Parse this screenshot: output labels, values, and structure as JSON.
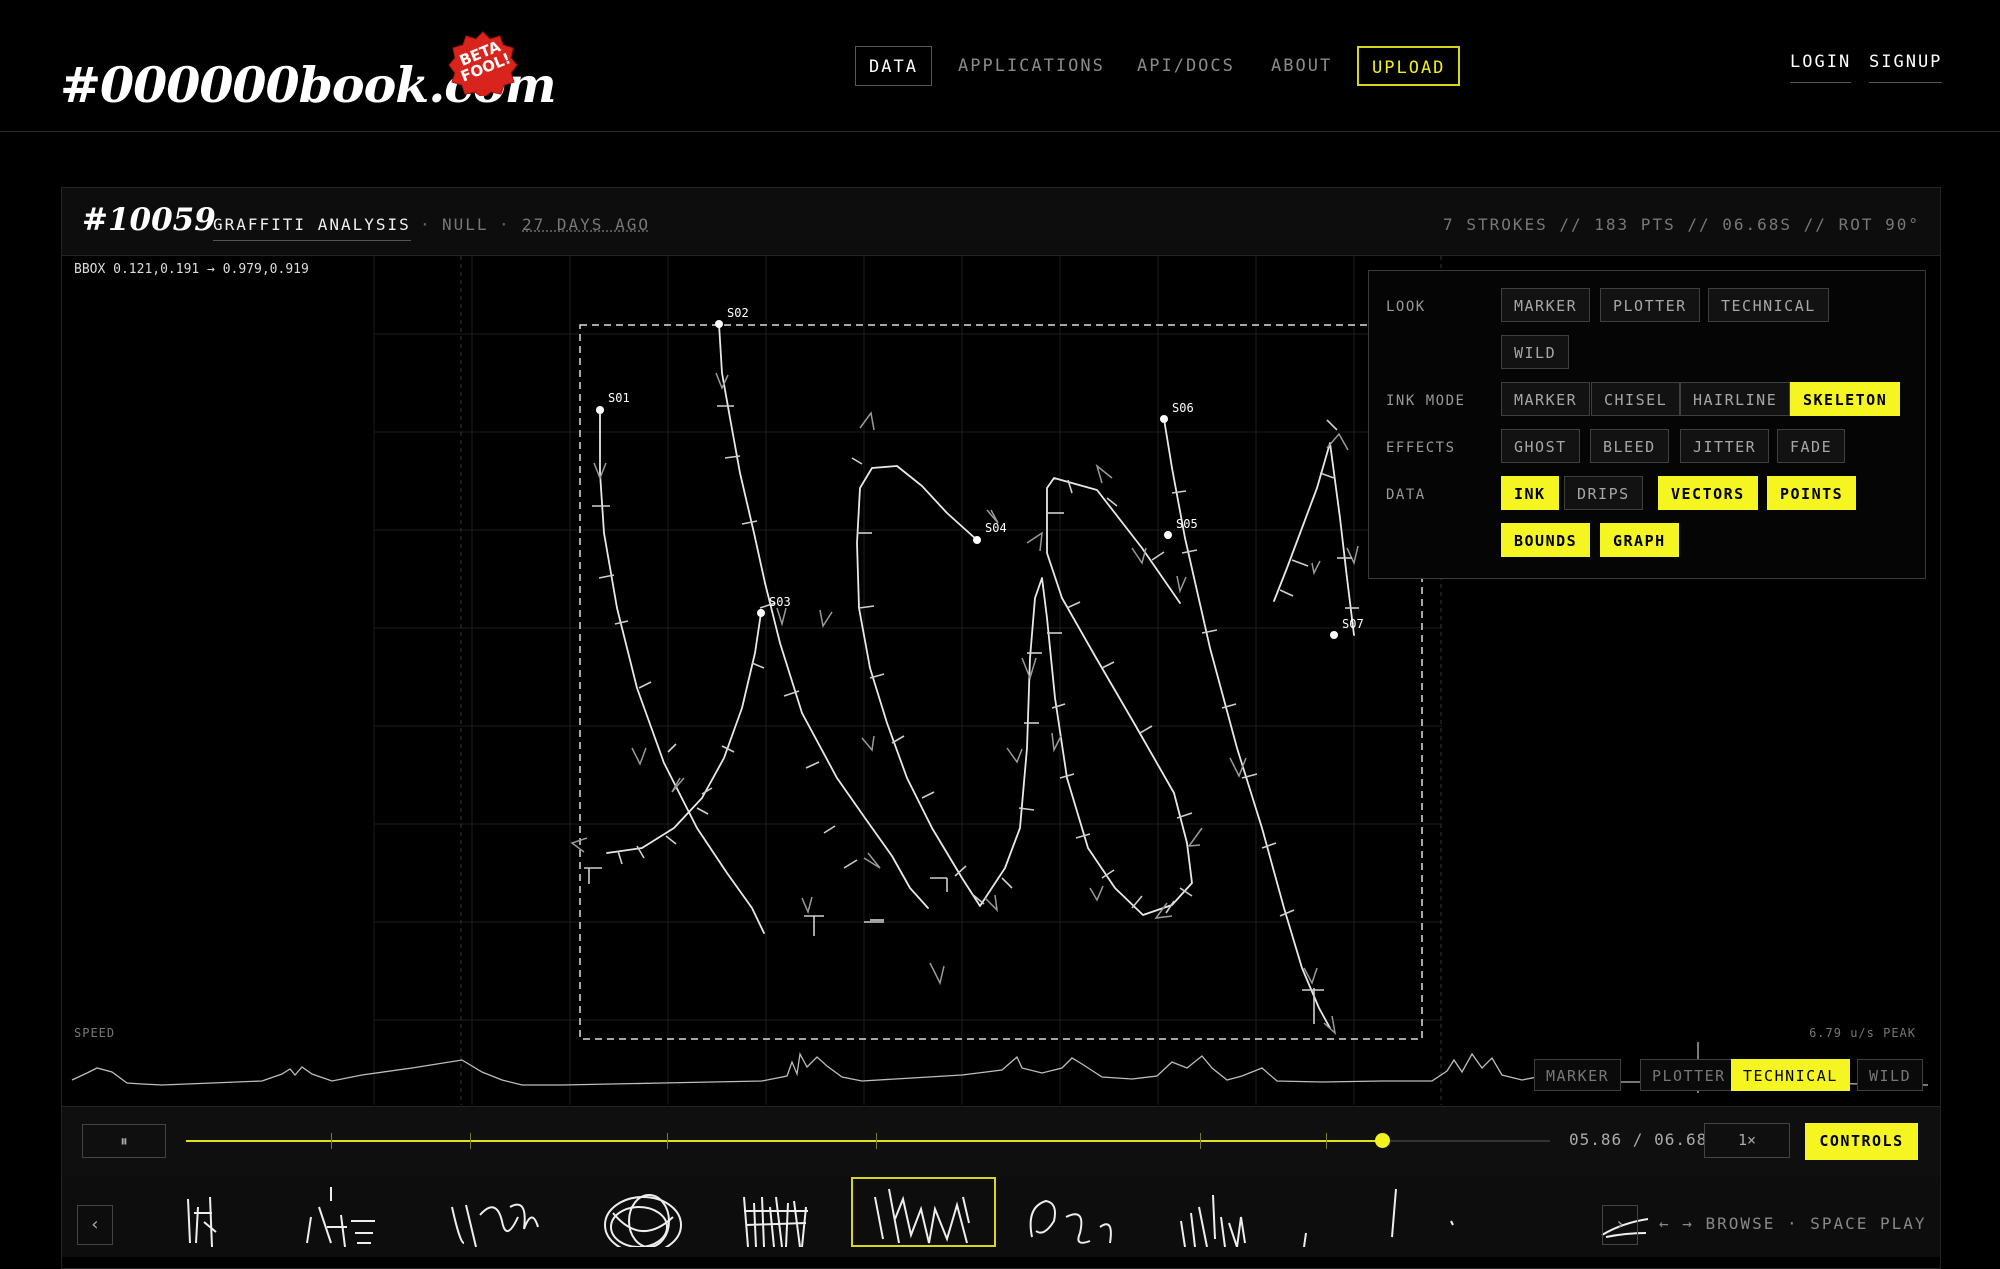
{
  "header": {
    "logo": "#000000book.com",
    "badge": "BETA FOOL!",
    "nav": [
      "DATA",
      "APPLICATIONS",
      "API/DOCS",
      "ABOUT",
      "UPLOAD"
    ],
    "login": "LOGIN",
    "signup": "SIGNUP"
  },
  "panel": {
    "id": "#10059",
    "title": "GRAFFITI ANALYSIS",
    "sep": "·",
    "author": "NULL",
    "date": "27 DAYS AGO",
    "stats": "7 STROKES // 183 PTS // 06.68S // ROT 90°",
    "bbox": "BBOX 0.121,0.191 → 0.979,0.919",
    "stroke_labels": [
      "S01",
      "S02",
      "S03",
      "S04",
      "S05",
      "S06",
      "S07"
    ]
  },
  "controls": {
    "look_label": "LOOK",
    "look": [
      "MARKER",
      "PLOTTER",
      "TECHNICAL",
      "WILD"
    ],
    "ink_label": "INK MODE",
    "ink": [
      "MARKER",
      "CHISEL",
      "HAIRLINE",
      "SKELETON"
    ],
    "ink_selected": "SKELETON",
    "effects_label": "EFFECTS",
    "effects": [
      "GHOST",
      "BLEED",
      "JITTER",
      "FADE"
    ],
    "data_label": "DATA",
    "data": [
      "INK",
      "DRIPS",
      "VECTORS",
      "POINTS",
      "BOUNDS",
      "GRAPH"
    ],
    "data_selected": [
      "INK",
      "VECTORS",
      "POINTS",
      "BOUNDS",
      "GRAPH"
    ]
  },
  "speed": {
    "label": "SPEED",
    "peak": "6.79 u/s PEAK",
    "look": [
      "MARKER",
      "PLOTTER",
      "TECHNICAL",
      "WILD"
    ],
    "look_selected": "TECHNICAL"
  },
  "transport": {
    "play_icon": "⏸",
    "progress": 0.877,
    "time": "05.86 / 06.68",
    "rate": "1×",
    "controls": "CONTROLS"
  },
  "browse": {
    "prev": "‹",
    "next": "›",
    "hint": "← → BROWSE · SPACE PLAY",
    "selected_index": 4
  },
  "colors": {
    "accent": "#f5f522",
    "background": "#000000",
    "stroke": "#e8e8e8"
  }
}
